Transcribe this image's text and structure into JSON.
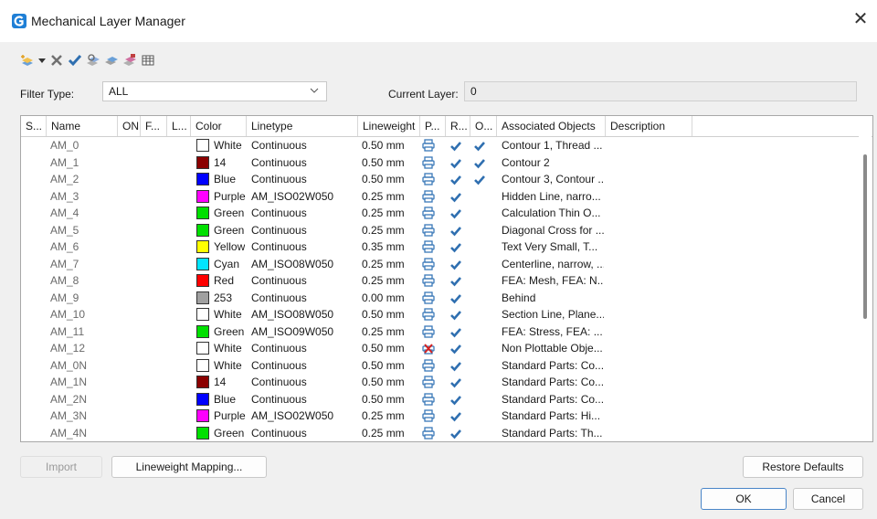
{
  "window": {
    "title": "Mechanical Layer Manager",
    "close_symbol": "✕"
  },
  "toolbar": {
    "icons": [
      "new-layer-icon",
      "dropdown-arrow-icon",
      "delete-icon",
      "set-current-icon",
      "filter-layers-icon",
      "layer-states-icon",
      "layer-walk-icon",
      "table-icon"
    ]
  },
  "filter": {
    "label": "Filter Type:",
    "value": "ALL"
  },
  "current_layer": {
    "label": "Current Layer:",
    "value": "0"
  },
  "table": {
    "columns": [
      "S...",
      "Name",
      "ON",
      "F...",
      "L...",
      "Color",
      "Linetype",
      "Lineweight",
      "P...",
      "R...",
      "O...",
      "Associated Objects",
      "Description"
    ],
    "rows": [
      {
        "name": "AM_0",
        "color": "#ffffff",
        "color_name": "White",
        "linetype": "Continuous",
        "lineweight": "0.50 mm",
        "plot": "printer",
        "r": true,
        "o": true,
        "assoc": "Contour 1, Thread ..."
      },
      {
        "name": "AM_1",
        "color": "#8b0000",
        "color_name": "14",
        "linetype": "Continuous",
        "lineweight": "0.50 mm",
        "plot": "printer",
        "r": true,
        "o": true,
        "assoc": "Contour 2"
      },
      {
        "name": "AM_2",
        "color": "#0000ff",
        "color_name": "Blue",
        "linetype": "Continuous",
        "lineweight": "0.50 mm",
        "plot": "printer",
        "r": true,
        "o": true,
        "assoc": "Contour 3, Contour ..."
      },
      {
        "name": "AM_3",
        "color": "#ff00ff",
        "color_name": "Purple",
        "linetype": "AM_ISO02W050",
        "lineweight": "0.25 mm",
        "plot": "printer",
        "r": true,
        "o": false,
        "assoc": "Hidden Line, narro..."
      },
      {
        "name": "AM_4",
        "color": "#00e000",
        "color_name": "Green",
        "linetype": "Continuous",
        "lineweight": "0.25 mm",
        "plot": "printer",
        "r": true,
        "o": false,
        "assoc": "Calculation Thin O..."
      },
      {
        "name": "AM_5",
        "color": "#00e000",
        "color_name": "Green",
        "linetype": "Continuous",
        "lineweight": "0.25 mm",
        "plot": "printer",
        "r": true,
        "o": false,
        "assoc": "Diagonal Cross for ..."
      },
      {
        "name": "AM_6",
        "color": "#ffff00",
        "color_name": "Yellow",
        "linetype": "Continuous",
        "lineweight": "0.35 mm",
        "plot": "printer",
        "r": true,
        "o": false,
        "assoc": "Text Very Small, T..."
      },
      {
        "name": "AM_7",
        "color": "#00e5ff",
        "color_name": "Cyan",
        "linetype": "AM_ISO08W050",
        "lineweight": "0.25 mm",
        "plot": "printer",
        "r": true,
        "o": false,
        "assoc": "Centerline, narrow, ..."
      },
      {
        "name": "AM_8",
        "color": "#ff0000",
        "color_name": "Red",
        "linetype": "Continuous",
        "lineweight": "0.25 mm",
        "plot": "printer",
        "r": true,
        "o": false,
        "assoc": "FEA: Mesh, FEA: N..."
      },
      {
        "name": "AM_9",
        "color": "#a0a0a0",
        "color_name": "253",
        "linetype": "Continuous",
        "lineweight": "0.00 mm",
        "plot": "printer",
        "r": true,
        "o": false,
        "assoc": "Behind"
      },
      {
        "name": "AM_10",
        "color": "#ffffff",
        "color_name": "White",
        "linetype": "AM_ISO08W050",
        "lineweight": "0.50 mm",
        "plot": "printer",
        "r": true,
        "o": false,
        "assoc": "Section Line, Plane..."
      },
      {
        "name": "AM_11",
        "color": "#00e000",
        "color_name": "Green",
        "linetype": "AM_ISO09W050",
        "lineweight": "0.25 mm",
        "plot": "printer",
        "r": true,
        "o": false,
        "assoc": "FEA: Stress, FEA: ..."
      },
      {
        "name": "AM_12",
        "color": "#ffffff",
        "color_name": "White",
        "linetype": "Continuous",
        "lineweight": "0.50 mm",
        "plot": "no-plot",
        "r": true,
        "o": false,
        "assoc": "Non Plottable Obje..."
      },
      {
        "name": "AM_0N",
        "color": "#ffffff",
        "color_name": "White",
        "linetype": "Continuous",
        "lineweight": "0.50 mm",
        "plot": "printer",
        "r": true,
        "o": false,
        "assoc": "Standard Parts: Co..."
      },
      {
        "name": "AM_1N",
        "color": "#8b0000",
        "color_name": "14",
        "linetype": "Continuous",
        "lineweight": "0.50 mm",
        "plot": "printer",
        "r": true,
        "o": false,
        "assoc": "Standard Parts: Co..."
      },
      {
        "name": "AM_2N",
        "color": "#0000ff",
        "color_name": "Blue",
        "linetype": "Continuous",
        "lineweight": "0.50 mm",
        "plot": "printer",
        "r": true,
        "o": false,
        "assoc": "Standard Parts: Co..."
      },
      {
        "name": "AM_3N",
        "color": "#ff00ff",
        "color_name": "Purple",
        "linetype": "AM_ISO02W050",
        "lineweight": "0.25 mm",
        "plot": "printer",
        "r": true,
        "o": false,
        "assoc": "Standard Parts: Hi..."
      },
      {
        "name": "AM_4N",
        "color": "#00e000",
        "color_name": "Green",
        "linetype": "Continuous",
        "lineweight": "0.25 mm",
        "plot": "printer",
        "r": true,
        "o": false,
        "assoc": "Standard Parts: Th..."
      }
    ]
  },
  "buttons": {
    "import": "Import",
    "lineweight_mapping": "Lineweight Mapping...",
    "restore_defaults": "Restore Defaults",
    "ok": "OK",
    "cancel": "Cancel"
  },
  "colors": {
    "check": "#2f6fb0",
    "printer": "#3a78b8",
    "no_plot": "#d42020"
  }
}
